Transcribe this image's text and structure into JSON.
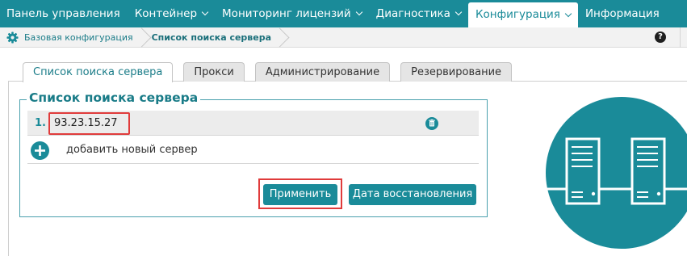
{
  "nav": {
    "items": [
      {
        "label": "Панель управления",
        "dropdown": false,
        "active": false
      },
      {
        "label": "Контейнер",
        "dropdown": true,
        "active": false
      },
      {
        "label": "Мониторинг лицензий",
        "dropdown": true,
        "active": false
      },
      {
        "label": "Диагностика",
        "dropdown": true,
        "active": false
      },
      {
        "label": "Конфигурация",
        "dropdown": true,
        "active": true
      },
      {
        "label": "Информация",
        "dropdown": false,
        "active": false
      }
    ]
  },
  "breadcrumb": {
    "items": [
      "Базовая конфигурация",
      "Список поиска сервера"
    ],
    "help_label": "?"
  },
  "tabs": [
    {
      "label": "Список поиска сервера",
      "active": true
    },
    {
      "label": "Прокси",
      "active": false
    },
    {
      "label": "Администрирование",
      "active": false
    },
    {
      "label": "Резервирование",
      "active": false
    }
  ],
  "server_list": {
    "legend": "Список поиска сервера",
    "servers": [
      {
        "index": "1.",
        "address": "93.23.15.27"
      }
    ],
    "add_label": "добавить новый сервер"
  },
  "buttons": {
    "apply": "Применить",
    "restore": "Дата восстановления"
  },
  "colors": {
    "accent": "#1a8b99",
    "highlight": "#e03b3b"
  },
  "icons": {
    "breadcrumb": "gear-icon",
    "help": "help-icon",
    "delete": "trash-icon",
    "add": "plus-circle-icon",
    "illustration": "servers-icon"
  }
}
